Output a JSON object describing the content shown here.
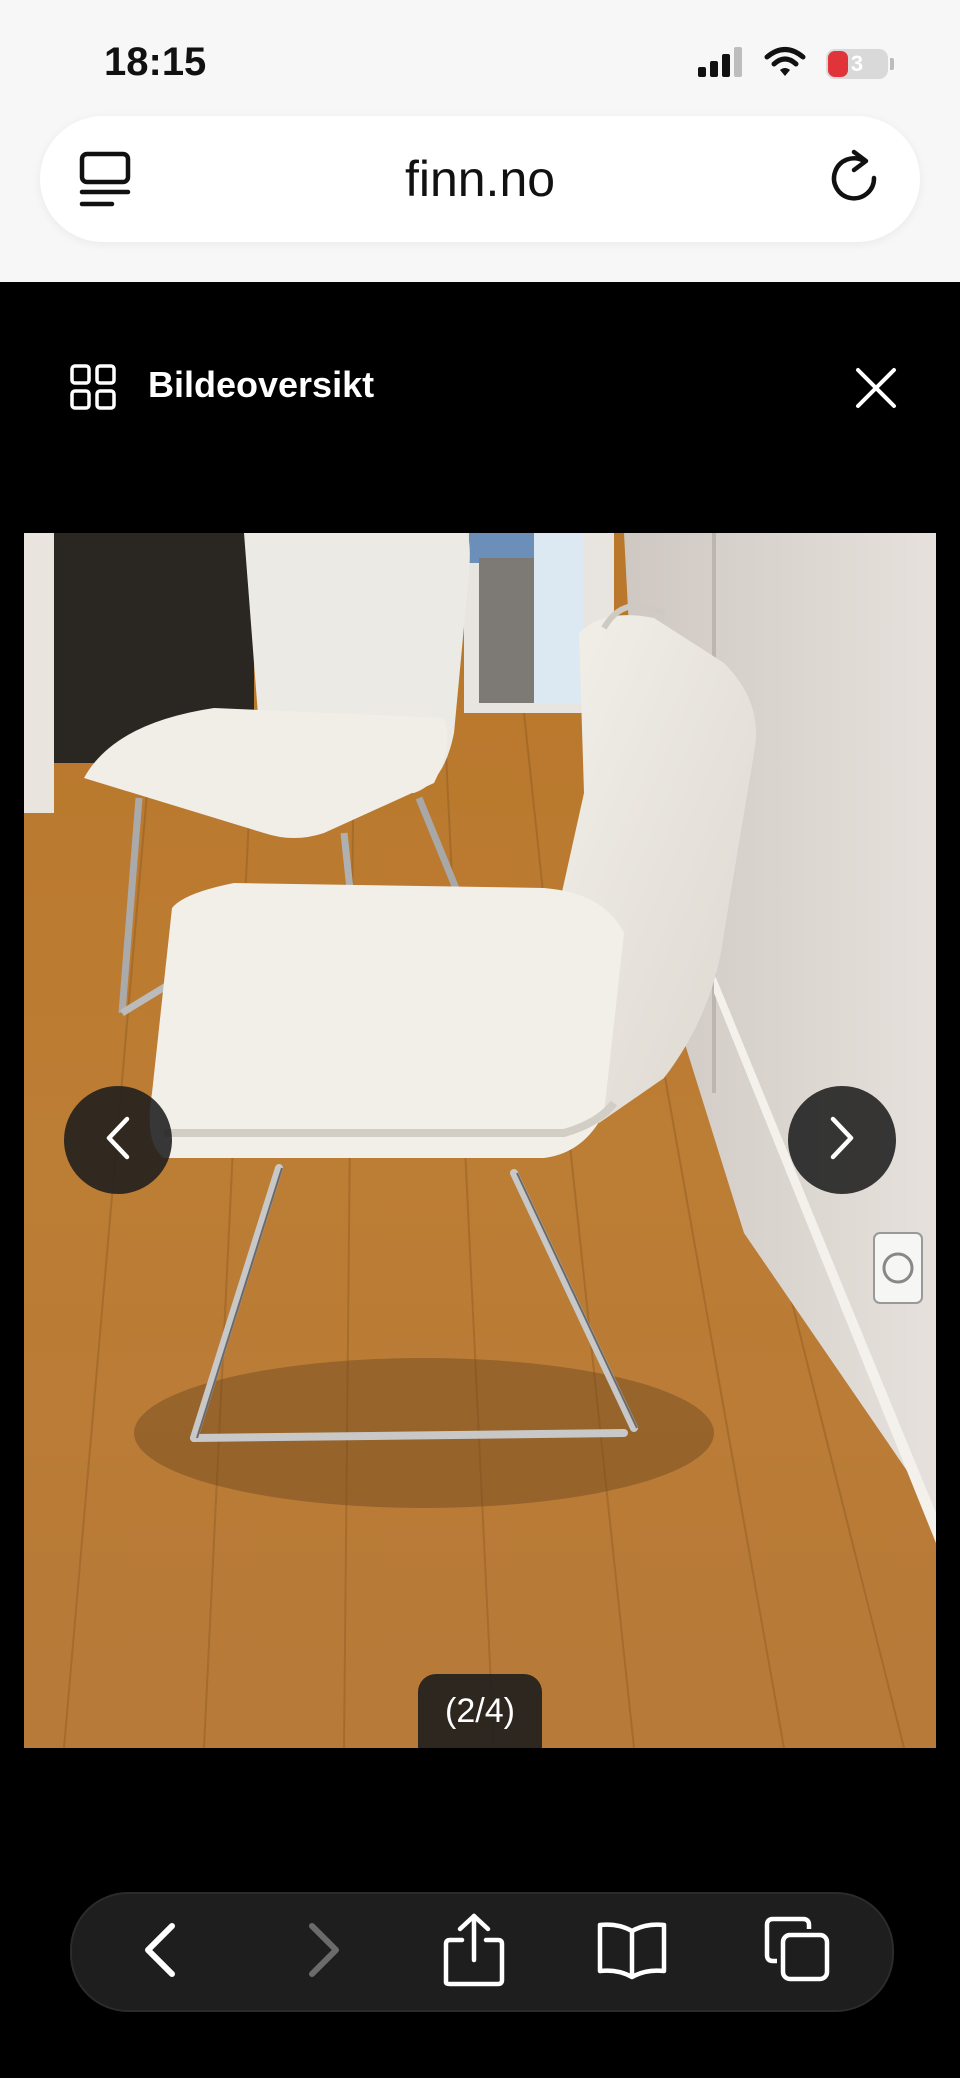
{
  "status_bar": {
    "time": "18:15",
    "battery_level": "3",
    "icons": [
      "cellular-signal-icon",
      "wifi-icon",
      "battery-icon"
    ]
  },
  "address_bar": {
    "url_text": "finn.no",
    "left_icon": "page-menu-icon",
    "right_icon": "reload-icon"
  },
  "viewer": {
    "title": "Bildeoversikt",
    "grid_icon": "grid-icon",
    "close_icon": "close-icon",
    "counter": "(2/4)",
    "prev_icon": "chevron-left-icon",
    "next_icon": "chevron-right-icon"
  },
  "toolbar": {
    "items": [
      "back-icon",
      "forward-icon",
      "share-icon",
      "bookmarks-icon",
      "tabs-icon"
    ]
  },
  "colors": {
    "header_bg": "#f7f7f7",
    "viewer_bg": "#000000",
    "button_bg": "#1e1e1e",
    "battery_red": "#e0343a"
  }
}
